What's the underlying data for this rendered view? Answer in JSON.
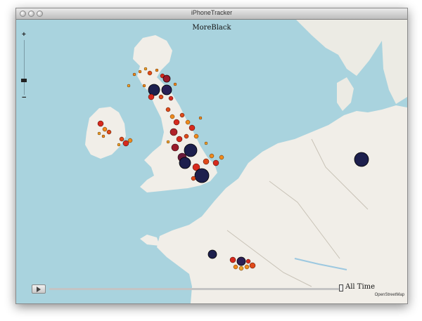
{
  "window": {
    "title": "iPhoneTracker"
  },
  "map": {
    "overlay_title": "MoreBlack",
    "attribution": "OpenStreetMap",
    "zoom_in": "+",
    "zoom_out": "−"
  },
  "timeline": {
    "label": "All Time"
  },
  "colors": {
    "sea": "#a9d3de",
    "land": "#f1eee8",
    "dot_hot": "#d62a1e",
    "dot_warm": "#f08a1c",
    "dot_dark": "#1d1f4d"
  },
  "icons": {
    "play": "play-icon",
    "zoom_in": "plus-icon",
    "zoom_out": "minus-icon"
  }
}
